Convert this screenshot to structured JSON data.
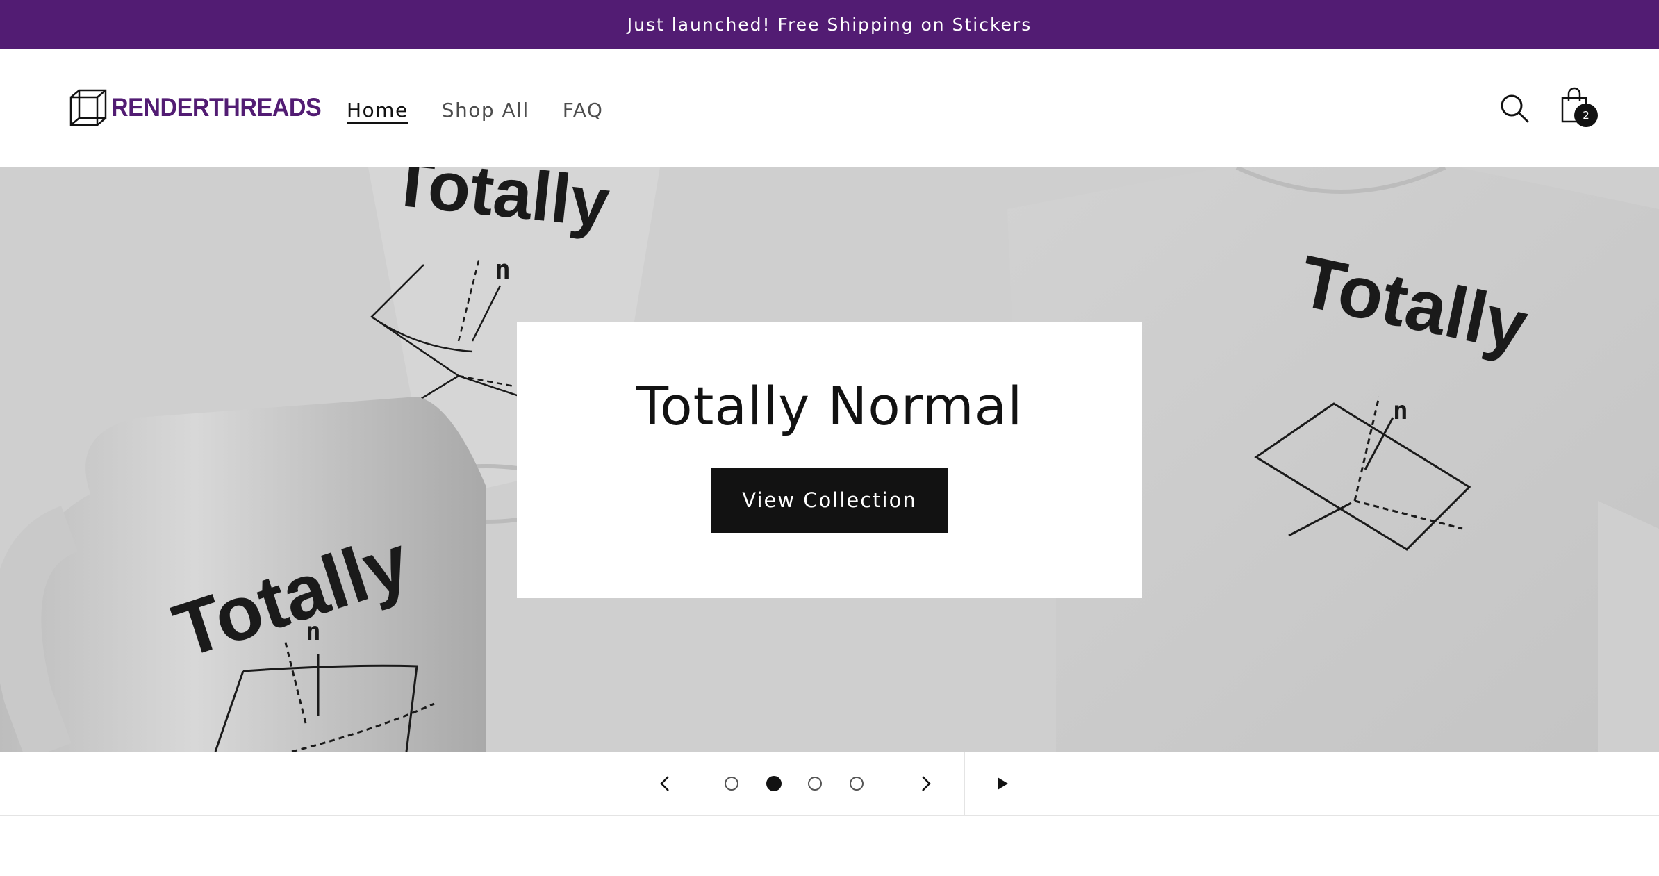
{
  "announcement": {
    "text": "Just launched! Free Shipping on Stickers"
  },
  "header": {
    "logo_text": "RENDERTHREADS",
    "nav": [
      {
        "label": "Home",
        "active": true
      },
      {
        "label": "Shop All",
        "active": false
      },
      {
        "label": "FAQ",
        "active": false
      }
    ],
    "cart_count": "2"
  },
  "hero": {
    "title": "Totally Normal",
    "button_label": "View Collection",
    "background_print_text": "Totally",
    "background_label": "n"
  },
  "slider": {
    "total_slides": 4,
    "active_slide": 2
  },
  "colors": {
    "brand": "#521c73",
    "dark": "#121212",
    "hero_bg": "#cfcfcf"
  }
}
